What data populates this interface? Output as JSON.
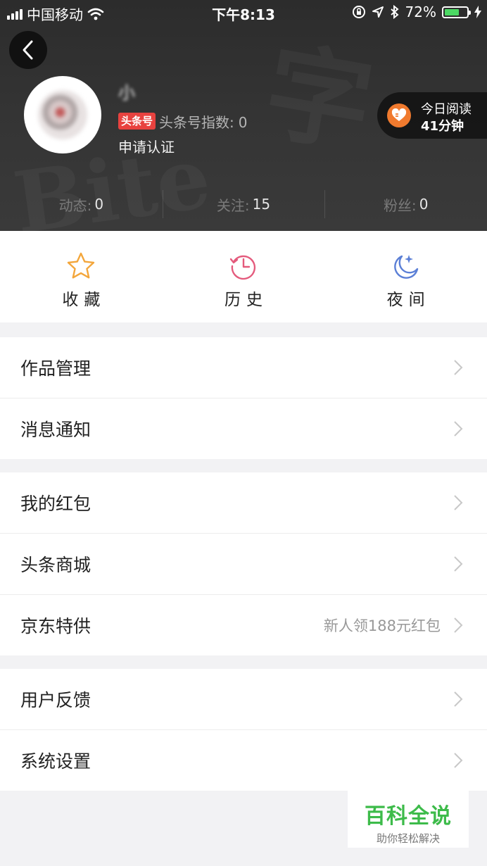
{
  "status_bar": {
    "carrier": "中国移动",
    "time": "下午8:13",
    "battery_percent": "72%",
    "battery_level": 0.72,
    "battery_color": "#4cd964"
  },
  "header": {
    "back_icon": "chevron-left-icon",
    "username": "小 ",
    "badge": "头条号",
    "index_label": "头条号指数:",
    "index_value": "0",
    "apply_cert": "申请认证",
    "today_read_line1": "今日阅读",
    "today_read_line2": "41分钟",
    "stats": [
      {
        "label": "动态:",
        "value": "0"
      },
      {
        "label": "关注:",
        "value": "15"
      },
      {
        "label": "粉丝:",
        "value": "0"
      }
    ]
  },
  "quick_actions": [
    {
      "label": "收藏",
      "icon": "star-icon",
      "color": "#f3a63b"
    },
    {
      "label": "历史",
      "icon": "clock-history-icon",
      "color": "#e45a7c"
    },
    {
      "label": "夜间",
      "icon": "moon-icon",
      "color": "#5b7fd6"
    }
  ],
  "menu_groups": [
    {
      "items": [
        {
          "label": "作品管理"
        },
        {
          "label": "消息通知"
        }
      ]
    },
    {
      "items": [
        {
          "label": "我的红包"
        },
        {
          "label": "头条商城"
        },
        {
          "label": "京东特供",
          "extra": "新人领188元红包"
        }
      ]
    },
    {
      "items": [
        {
          "label": "用户反馈"
        },
        {
          "label": "系统设置"
        }
      ]
    }
  ],
  "watermark": {
    "title": "百科全说",
    "subtitle": "助你轻松解决"
  }
}
